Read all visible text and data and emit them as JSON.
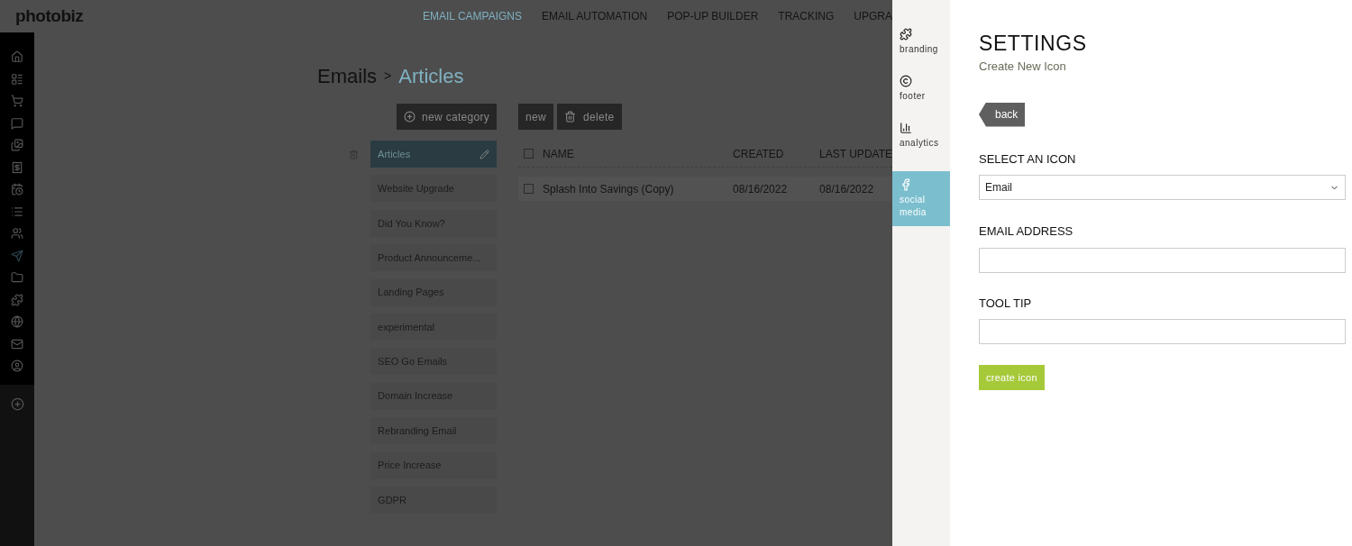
{
  "logo": "photobiz",
  "nav": [
    {
      "label": "EMAIL CAMPAIGNS",
      "selected": true
    },
    {
      "label": "EMAIL AUTOMATION",
      "selected": false
    },
    {
      "label": "POP-UP BUILDER",
      "selected": false
    },
    {
      "label": "TRACKING",
      "selected": false
    },
    {
      "label": "UPGRA",
      "selected": false
    }
  ],
  "sidebar": [
    {
      "selected": false
    },
    {
      "selected": false
    },
    {
      "selected": false
    },
    {
      "selected": false
    },
    {
      "selected": false
    },
    {
      "selected": false
    },
    {
      "selected": false
    },
    {
      "selected": false
    },
    {
      "selected": false
    },
    {
      "selected": true
    },
    {
      "selected": false
    },
    {
      "selected": false
    },
    {
      "selected": false
    },
    {
      "selected": false
    },
    {
      "selected": false
    }
  ],
  "breadcrumb": {
    "root": "Emails",
    "separator": ">",
    "current": "Articles"
  },
  "toolbar": {
    "new_category": "new category",
    "new": "new",
    "delete": "delete"
  },
  "categories": [
    {
      "label": "Articles",
      "selected": true
    },
    {
      "label": "Website Upgrade",
      "selected": false
    },
    {
      "label": "Did You Know?",
      "selected": false
    },
    {
      "label": "Product Announceme...",
      "selected": false
    },
    {
      "label": "Landing Pages",
      "selected": false
    },
    {
      "label": "experimental",
      "selected": false
    },
    {
      "label": "SEO Go Emails",
      "selected": false
    },
    {
      "label": "Domain Increase",
      "selected": false
    },
    {
      "label": "Rebranding Email",
      "selected": false
    },
    {
      "label": "Price Increase",
      "selected": false
    },
    {
      "label": "GDPR",
      "selected": false
    }
  ],
  "table": {
    "checked": false,
    "columns": [
      "NAME",
      "CREATED",
      "LAST UPDATE"
    ],
    "rows": [
      {
        "checked": false,
        "cells": [
          "Splash Into Savings (Copy)",
          "08/16/2022",
          "08/16/2022"
        ]
      }
    ]
  },
  "panel_tabs": [
    {
      "label": "branding",
      "selected": false
    },
    {
      "label": "footer",
      "selected": false
    },
    {
      "label": "analytics",
      "selected": false
    },
    {
      "label": "social media",
      "selected": true
    }
  ],
  "settings": {
    "title": "SETTINGS",
    "subtitle": "Create New Icon",
    "back": "back",
    "select_label": "SELECT AN ICON",
    "select_value": "Email",
    "email_label": "EMAIL ADDRESS",
    "tooltip_label": "TOOL TIP",
    "submit": "create icon"
  }
}
